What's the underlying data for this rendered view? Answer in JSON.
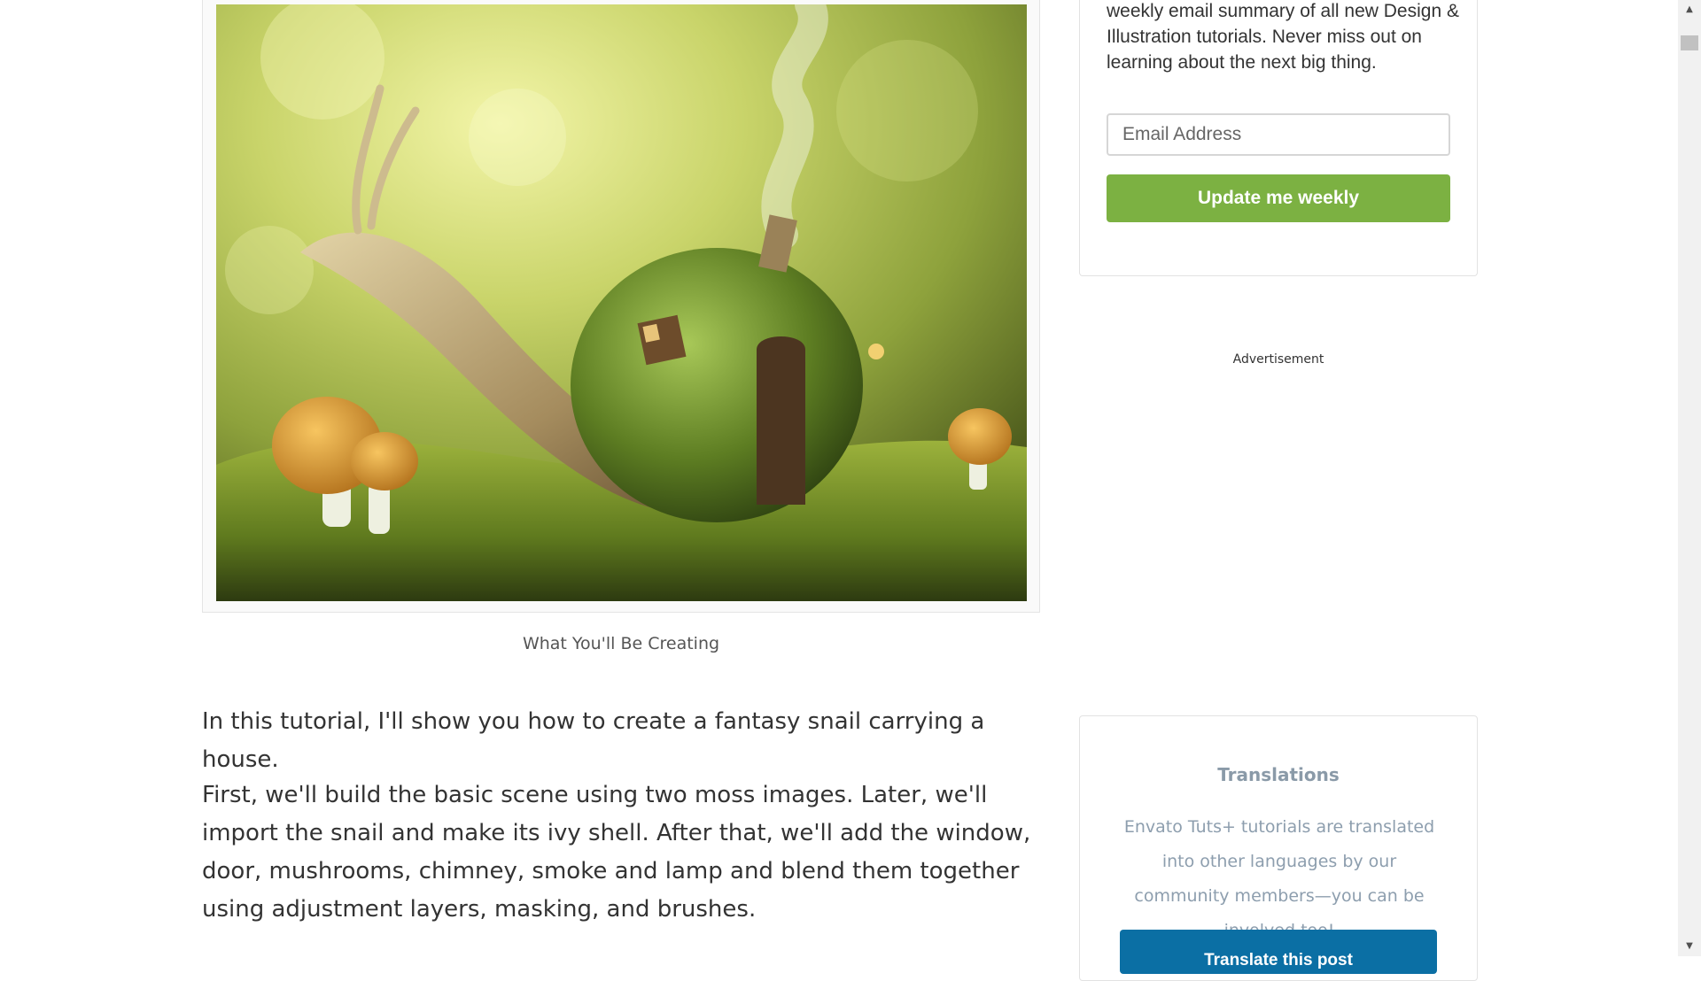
{
  "hero": {
    "caption": "What You'll Be Creating"
  },
  "article": {
    "intro": "In this tutorial, I'll show you how to create a fantasy snail carrying a house.",
    "body": "First, we'll build the basic scene using two moss images. Later, we'll import the snail and make its ivy shell. After that, we'll add the window, door, mushrooms, chimney, smoke and lamp and blend them together using adjustment layers, masking, and brushes."
  },
  "newsletter": {
    "text": "weekly email summary of all new Design & Illustration tutorials. Never miss out on learning about the next big thing.",
    "email_placeholder": "Email Address",
    "button_label": "Update me weekly",
    "button_color": "#7cb142"
  },
  "advertisement": {
    "label": "Advertisement"
  },
  "translations": {
    "title": "Translations",
    "text": "Envato Tuts+ tutorials are translated into other languages by our community members—you can be involved too!",
    "button_label": "Translate this post",
    "button_color": "#0b6fa4"
  },
  "scrollbar": {
    "up_icon": "triangle-up-icon",
    "down_icon": "triangle-down-icon"
  }
}
